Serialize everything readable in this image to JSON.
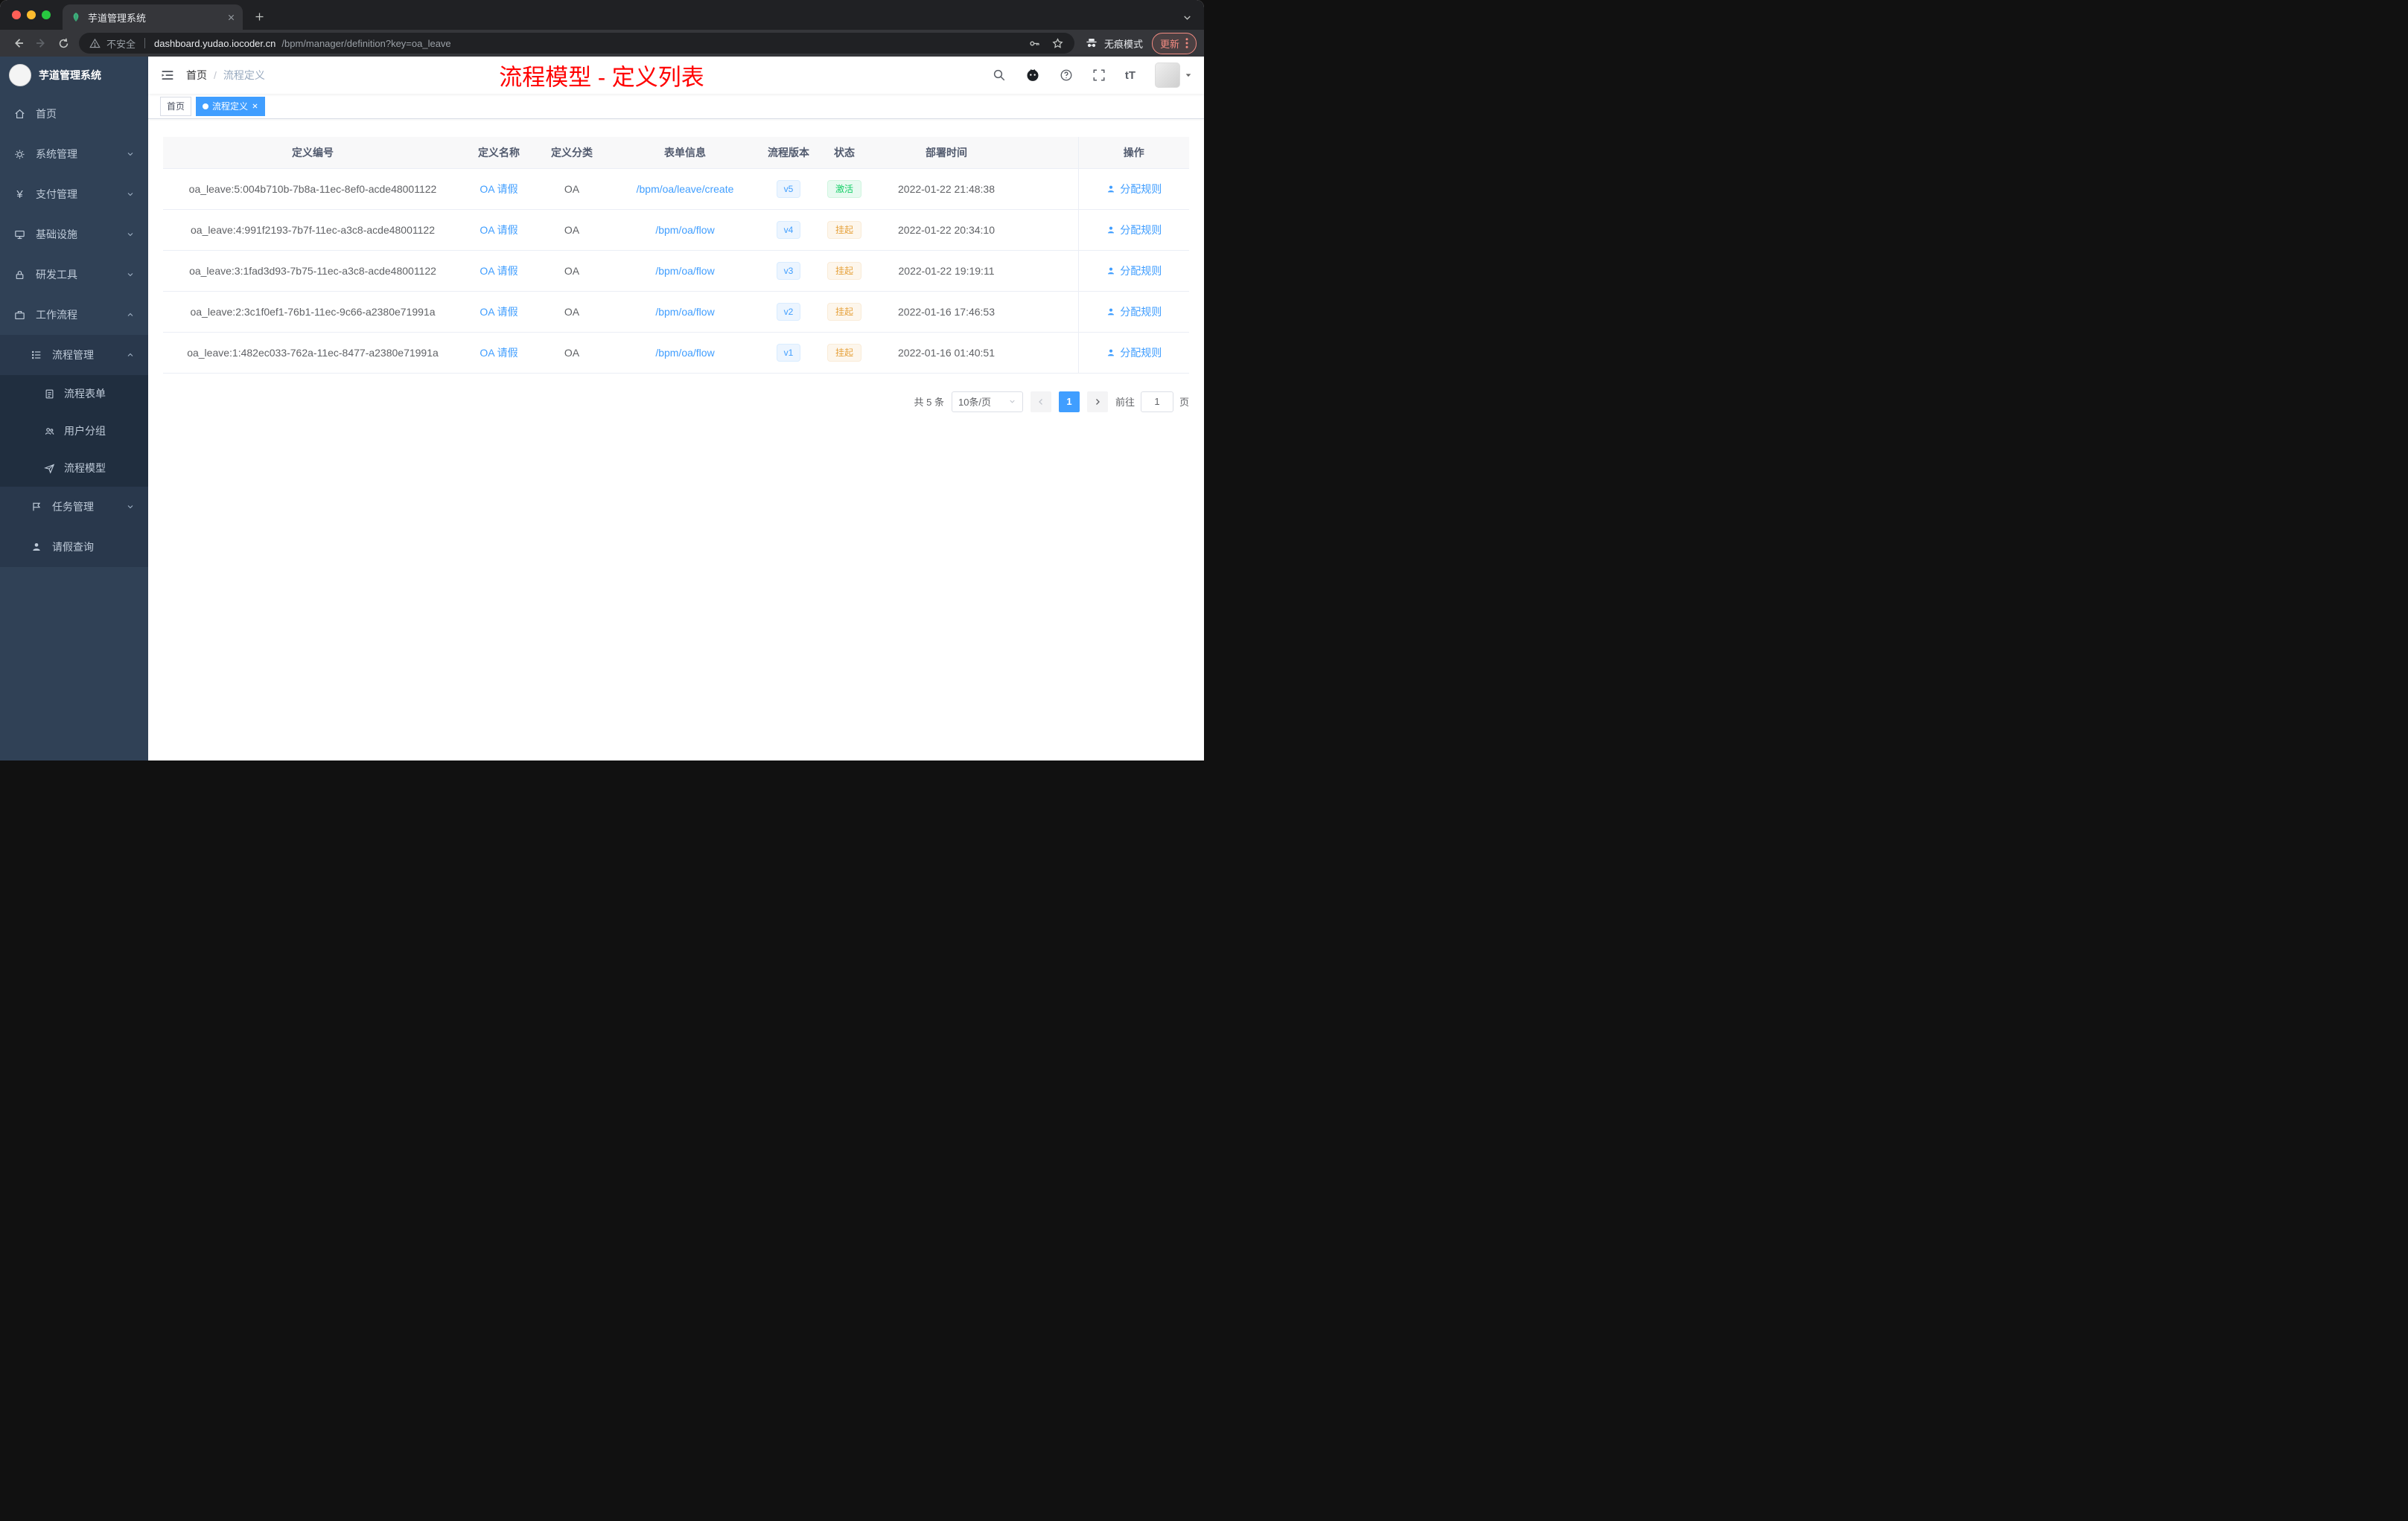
{
  "browser": {
    "tab_title": "芋道管理系统",
    "security_label": "不安全",
    "url_domain": "dashboard.yudao.iocoder.cn",
    "url_path": "/bpm/manager/definition?key=oa_leave",
    "incognito_label": "无痕模式",
    "update_label": "更新"
  },
  "sidebar": {
    "logo_title": "芋道管理系统",
    "items": [
      {
        "label": "首页"
      },
      {
        "label": "系统管理"
      },
      {
        "label": "支付管理"
      },
      {
        "label": "基础设施"
      },
      {
        "label": "研发工具"
      },
      {
        "label": "工作流程"
      }
    ],
    "process_menu": {
      "label": "流程管理"
    },
    "process_children": [
      {
        "label": "流程表单"
      },
      {
        "label": "用户分组"
      },
      {
        "label": "流程模型"
      }
    ],
    "task_menu": {
      "label": "任务管理"
    },
    "leave_item": {
      "label": "请假查询"
    }
  },
  "navbar": {
    "breadcrumb_home": "首页",
    "breadcrumb_sep": "/",
    "breadcrumb_current": "流程定义",
    "annotation": "流程模型 - 定义列表",
    "font_icon": "tT"
  },
  "tags": {
    "home": "首页",
    "current": "流程定义"
  },
  "table": {
    "columns": {
      "id": "定义编号",
      "name": "定义名称",
      "category": "定义分类",
      "form": "表单信息",
      "version": "流程版本",
      "status": "状态",
      "time": "部署时间",
      "actions": "操作"
    },
    "rows": [
      {
        "id": "oa_leave:5:004b710b-7b8a-11ec-8ef0-acde48001122",
        "name": "OA 请假",
        "category": "OA",
        "form": "/bpm/oa/leave/create",
        "version": "v5",
        "status": "激活",
        "status_type": "success",
        "time": "2022-01-22 21:48:38",
        "action": "分配规则"
      },
      {
        "id": "oa_leave:4:991f2193-7b7f-11ec-a3c8-acde48001122",
        "name": "OA 请假",
        "category": "OA",
        "form": "/bpm/oa/flow",
        "version": "v4",
        "status": "挂起",
        "status_type": "warning",
        "time": "2022-01-22 20:34:10",
        "action": "分配规则"
      },
      {
        "id": "oa_leave:3:1fad3d93-7b75-11ec-a3c8-acde48001122",
        "name": "OA 请假",
        "category": "OA",
        "form": "/bpm/oa/flow",
        "version": "v3",
        "status": "挂起",
        "status_type": "warning",
        "time": "2022-01-22 19:19:11",
        "action": "分配规则"
      },
      {
        "id": "oa_leave:2:3c1f0ef1-76b1-11ec-9c66-a2380e71991a",
        "name": "OA 请假",
        "category": "OA",
        "form": "/bpm/oa/flow",
        "version": "v2",
        "status": "挂起",
        "status_type": "warning",
        "time": "2022-01-16 17:46:53",
        "action": "分配规则"
      },
      {
        "id": "oa_leave:1:482ec033-762a-11ec-8477-a2380e71991a",
        "name": "OA 请假",
        "category": "OA",
        "form": "/bpm/oa/flow",
        "version": "v1",
        "status": "挂起",
        "status_type": "warning",
        "time": "2022-01-16 01:40:51",
        "action": "分配规则"
      }
    ]
  },
  "pagination": {
    "total": "共 5 条",
    "page_size": "10条/页",
    "current": "1",
    "goto_label": "前往",
    "goto_value": "1",
    "page_unit": "页"
  },
  "colors": {
    "accent": "#409eff",
    "annotation_red": "#ff0000",
    "sidebar_bg": "#304156",
    "success_text": "#13ce66",
    "warning_text": "#e6a23c"
  }
}
